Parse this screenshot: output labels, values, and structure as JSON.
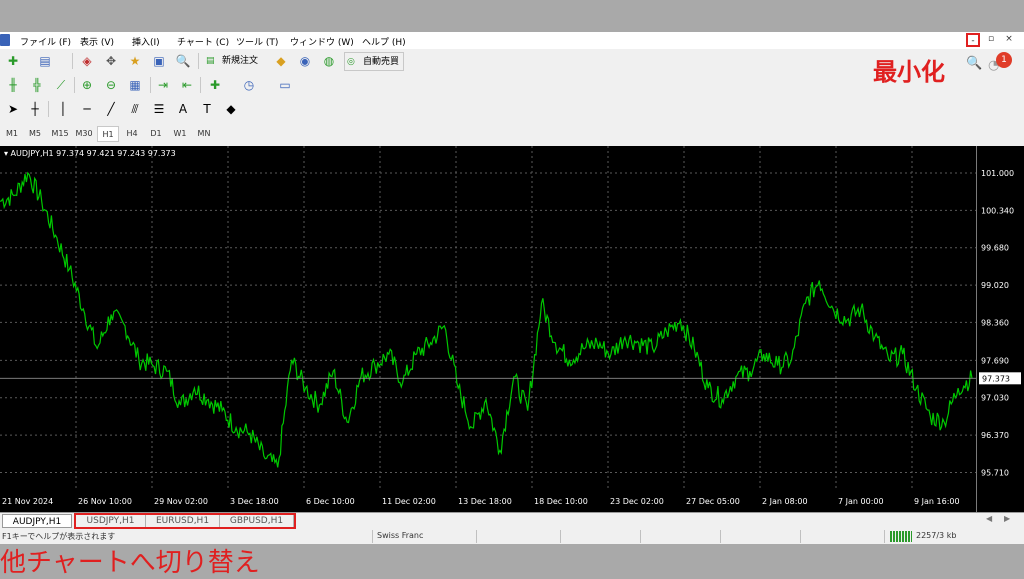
{
  "menu": {
    "items": [
      "ファイル (F)",
      "表示 (V)",
      "挿入(I)",
      "チャート (C)",
      "ツール (T)",
      "ウィンドウ (W)",
      "ヘルプ (H)"
    ],
    "minimize": "-",
    "restore": "▫",
    "close": "×"
  },
  "toolbar": {
    "new_order": "新規注文",
    "auto_trading": "自動売買"
  },
  "timeframes": [
    "M1",
    "M5",
    "M15",
    "M30",
    "H1",
    "H4",
    "D1",
    "W1",
    "MN"
  ],
  "active_timeframe": "H1",
  "chart": {
    "info": "▾ AUDJPY,H1  97.374 97.421 97.243 97.373",
    "current_price": "97.373",
    "price_labels": [
      "101.000",
      "100.340",
      "99.680",
      "99.020",
      "98.360",
      "97.690",
      "97.030",
      "96.370",
      "95.710"
    ],
    "time_labels": [
      "21 Nov 2024",
      "26 Nov 10:00",
      "29 Nov 02:00",
      "3 Dec 18:00",
      "6 Dec 10:00",
      "11 Dec 02:00",
      "13 Dec 18:00",
      "18 Dec 10:00",
      "23 Dec 02:00",
      "27 Dec 05:00",
      "2 Jan 08:00",
      "7 Jan 00:00",
      "9 Jan 16:00"
    ],
    "line_color": "#00c800",
    "grid_color": "#5a5a5a"
  },
  "chart_data": {
    "type": "line",
    "symbol": "AUDJPY",
    "timeframe": "H1",
    "ylim": [
      95.4,
      101.3
    ],
    "grid": true,
    "x": [
      "21 Nov 2024",
      "26 Nov 10:00",
      "29 Nov 02:00",
      "3 Dec 18:00",
      "6 Dec 10:00",
      "11 Dec 02:00",
      "13 Dec 18:00",
      "18 Dec 10:00",
      "23 Dec 02:00",
      "27 Dec 05:00",
      "2 Jan 08:00",
      "7 Jan 00:00",
      "9 Jan 16:00"
    ],
    "series": [
      {
        "values": [
          100.5,
          100.6,
          101.0,
          100.5,
          99.9,
          99.3,
          98.6,
          97.9,
          98.5,
          98.3,
          97.7,
          97.6,
          97.5,
          96.9,
          97.2,
          97.0,
          96.8,
          96.5,
          96.4,
          96.0,
          95.8,
          97.7,
          97.2,
          96.9,
          97.5,
          96.6,
          97.4,
          97.6,
          97.8,
          97.3,
          97.8,
          98.0,
          98.3,
          97.2,
          96.5,
          97.0,
          96.1,
          97.4,
          96.8,
          98.7,
          98.0,
          97.7,
          97.9,
          98.0,
          97.8,
          98.1,
          98.0,
          97.9,
          98.2,
          98.4,
          97.9,
          97.2,
          97.0,
          97.4,
          97.5,
          97.8,
          97.6,
          97.7,
          98.7,
          99.1,
          98.6,
          98.4,
          98.6,
          98.1,
          97.7,
          97.8,
          97.2,
          96.7,
          96.6,
          97.2,
          97.373
        ]
      }
    ]
  },
  "tabs": [
    "AUDJPY,H1",
    "USDJPY,H1",
    "EURUSD,H1",
    "GBPUSD,H1"
  ],
  "status": {
    "help": "F1キーでヘルプが表示されます",
    "profile": "Swiss Franc",
    "traffic": "2257/3 kb"
  },
  "annotations": {
    "minimize": "最小化",
    "switch": "他チャートへ切り替え"
  },
  "notification_count": "1"
}
